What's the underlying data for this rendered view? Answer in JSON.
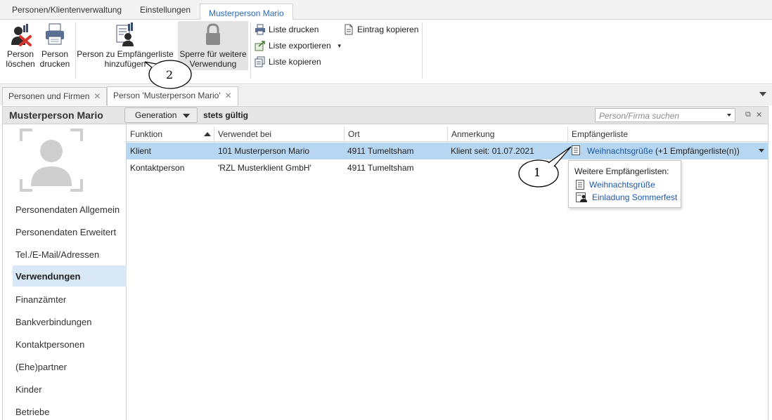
{
  "ribbon_tabs": [
    "Personen/Klientenverwaltung",
    "Einstellungen",
    "Musterperson Mario"
  ],
  "ribbon": {
    "delete_line1": "Person",
    "delete_line2": "löschen",
    "print_line1": "Person",
    "print_line2": "drucken",
    "add_list_line1": "Person zu Empfängerliste",
    "add_list_line2": "hinzufügen",
    "block_line1": "Sperre für weitere",
    "block_line2": "Verwendung",
    "print_list": "Liste drucken",
    "export_list": "Liste exportieren",
    "copy_list": "Liste kopieren",
    "copy_entry": "Eintrag kopieren"
  },
  "doc_tabs": [
    "Personen und Firmen",
    "Person 'Musterperson Mario'"
  ],
  "header": {
    "title": "Musterperson Mario",
    "generation": "Generation",
    "validity": "stets gültig",
    "search_placeholder": "Person/Firma suchen"
  },
  "nav": [
    "Personendaten Allgemein",
    "Personendaten Erweitert",
    "Tel./E-Mail/Adressen",
    "Verwendungen",
    "Finanzämter",
    "Bankverbindungen",
    "Kontaktpersonen",
    "(Ehe)partner",
    "Kinder",
    "Betriebe"
  ],
  "nav_active": "Verwendungen",
  "table": {
    "columns": [
      "Funktion",
      "Verwendet bei",
      "Ort",
      "Anmerkung",
      "Empfängerliste"
    ],
    "rows": [
      {
        "funktion": "Klient",
        "verwendet_bei": "101 Musterperson Mario",
        "ort": "4911 Tumeltsham",
        "anmerkung": "Klient seit: 01.07.2021",
        "empfaengerliste": "Weihnachtsgrüße",
        "extra": "(+1 Empfängerliste(n))"
      },
      {
        "funktion": "Kontaktperson",
        "verwendet_bei": "'RZL Musterklient GmbH'",
        "ort": "4911 Tumeltsham",
        "anmerkung": "",
        "empfaengerliste": "",
        "extra": ""
      }
    ]
  },
  "popup": {
    "heading": "Weitere Empfängerlisten:",
    "items": [
      "Weihnachtsgrüße",
      "Einladung Sommerfest"
    ]
  },
  "callouts": [
    "1",
    "2"
  ],
  "colors": {
    "accent": "#2b6ab7",
    "link": "#1d58a7",
    "selection": "#b7d6f1",
    "nav_active": "#d9e8f7",
    "delete_red": "#d9342b"
  }
}
